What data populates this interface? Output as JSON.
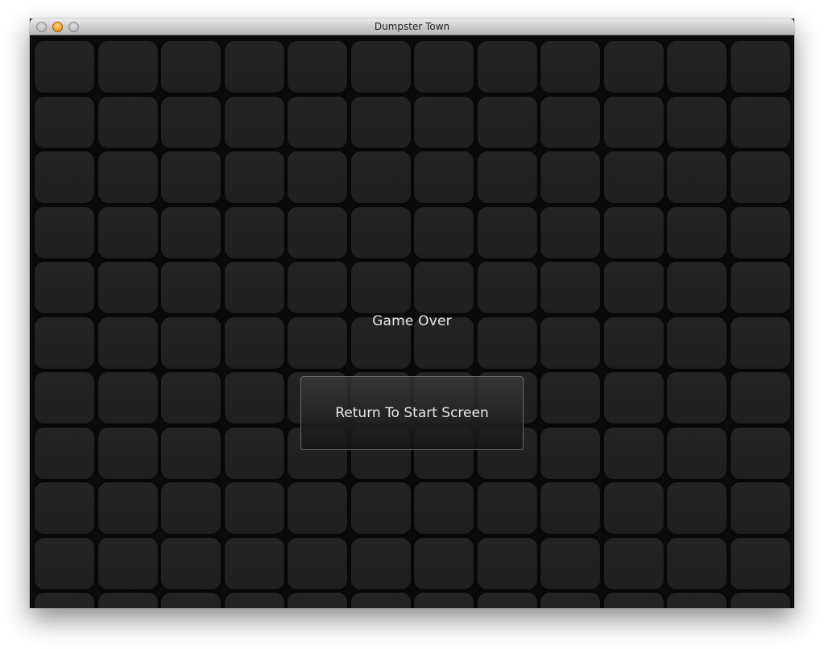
{
  "window": {
    "title": "Dumpster Town"
  },
  "game": {
    "status_text": "Game Over",
    "return_button_label": "Return To Start Screen"
  }
}
